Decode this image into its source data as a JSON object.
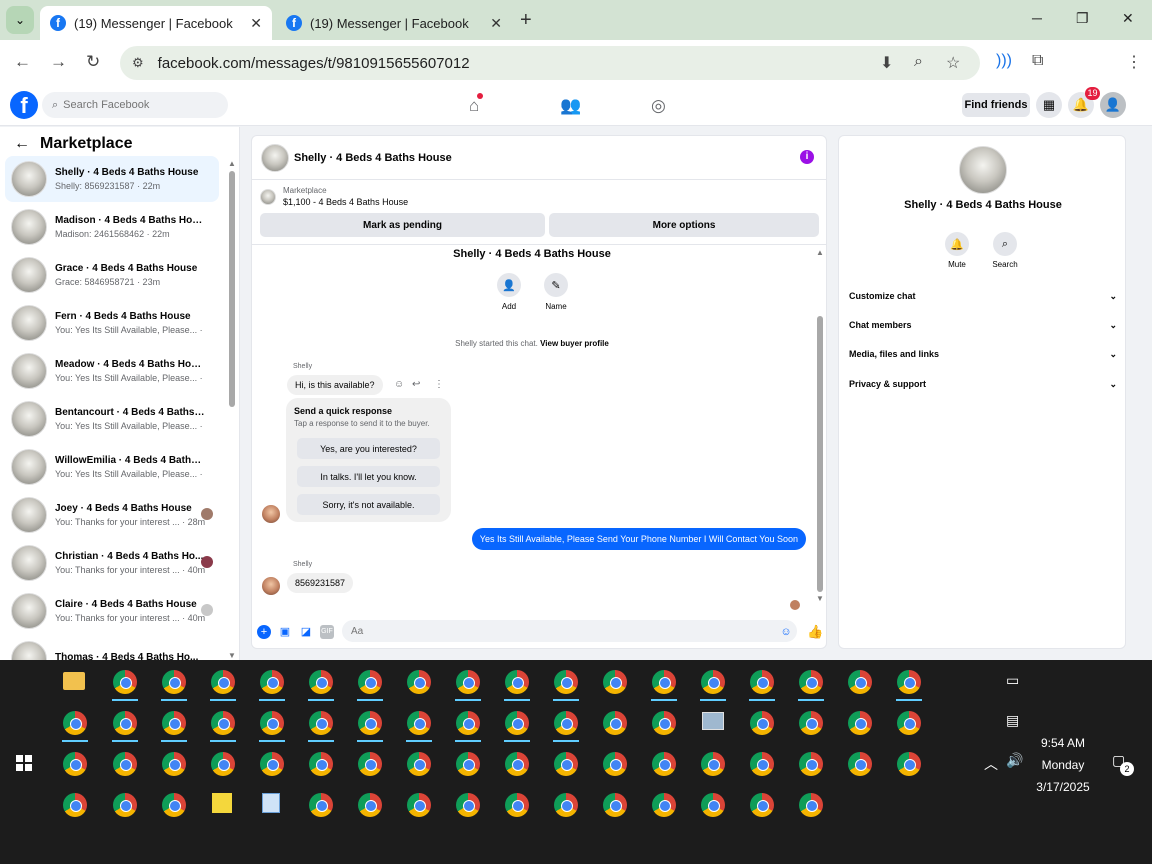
{
  "browser": {
    "tabs": [
      {
        "title": "(19) Messenger | Facebook",
        "active": true
      },
      {
        "title": "(19) Messenger | Facebook",
        "active": false
      }
    ],
    "url": "facebook.com/messages/t/9810915655607012"
  },
  "header": {
    "search_placeholder": "Search Facebook",
    "find_friends": "Find friends",
    "notification_count": "19"
  },
  "sidebar": {
    "title": "Marketplace",
    "conversations": [
      {
        "name": "Shelly · 4 Beds 4 Baths House",
        "preview": "Shelly: 8569231587 · 22m",
        "selected": true
      },
      {
        "name": "Madison · 4 Beds 4 Baths House",
        "preview": "Madison: 2461568462 · 22m"
      },
      {
        "name": "Grace · 4 Beds 4 Baths House",
        "preview": "Grace: 5846958721 · 23m"
      },
      {
        "name": "Fern · 4 Beds 4 Baths House",
        "preview": "You: Yes Its Still Available, Please... · 24m"
      },
      {
        "name": "Meadow · 4 Beds 4 Baths House",
        "preview": "You: Yes Its Still Available, Please... · 24m"
      },
      {
        "name": "Bentancourt · 4 Beds 4 Baths H...",
        "preview": "You: Yes Its Still Available, Please... · 24m"
      },
      {
        "name": "WillowEmilia · 4 Beds 4 Baths ...",
        "preview": "You: Yes Its Still Available, Please... · 24m"
      },
      {
        "name": "Joey · 4 Beds 4 Baths House",
        "preview": "You: Thanks for your interest ... · 28m"
      },
      {
        "name": "Christian · 4 Beds 4 Baths Ho...",
        "preview": "You: Thanks for your interest ... · 40m"
      },
      {
        "name": "Claire · 4 Beds 4 Baths House",
        "preview": "You: Thanks for your interest ... · 40m"
      },
      {
        "name": "Thomas · 4 Beds 4 Baths Ho...",
        "preview": ""
      }
    ]
  },
  "chat": {
    "header_name": "Shelly · 4 Beds 4 Baths House",
    "marketplace_label": "Marketplace",
    "listing": "$1,100 - 4 Beds 4 Baths House",
    "mark_pending": "Mark as pending",
    "more_options": "More options",
    "title": "Shelly · 4 Beds 4 Baths House",
    "add_label": "Add",
    "name_label": "Name",
    "started_text": "Shelly started this chat.",
    "view_profile": "View buyer profile",
    "sender": "Shelly",
    "msg1": "Hi, is this available?",
    "quick_title": "Send a quick response",
    "quick_sub": "Tap a response to send it to the buyer.",
    "quick_responses": [
      "Yes, are you interested?",
      "In talks. I'll let you know.",
      "Sorry, it's not available."
    ],
    "outgoing": "Yes Its Still Available, Please Send Your Phone Number I Will Contact You Soon",
    "msg2": "8569231587",
    "composer_placeholder": "Aa"
  },
  "info": {
    "name": "Shelly · 4 Beds 4 Baths House",
    "mute": "Mute",
    "search": "Search",
    "sections": [
      "Customize chat",
      "Chat members",
      "Media, files and links",
      "Privacy & support"
    ]
  },
  "taskbar": {
    "time": "9:54 AM",
    "day": "Monday",
    "date": "3/17/2025",
    "action_count": "2"
  },
  "colors": {
    "facebook_blue": "#0866ff",
    "chrome_tabbar": "#d3e3d3",
    "taskbar": "#1c1c1c",
    "info_purple": "#9b10e6"
  }
}
